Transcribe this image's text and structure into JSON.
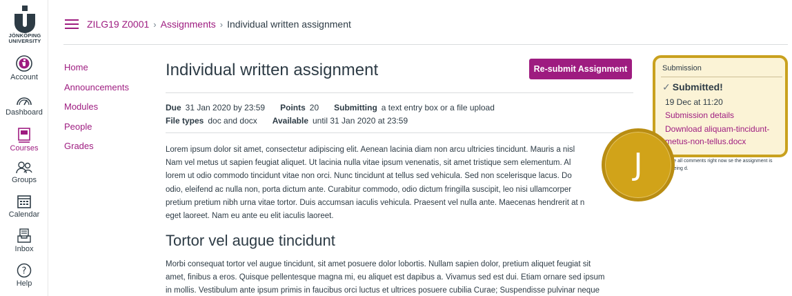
{
  "logo": {
    "line1": "JÖNKÖPING",
    "line2": "UNIVERSITY"
  },
  "global_nav": [
    {
      "label": "Account",
      "icon": "account-icon"
    },
    {
      "label": "Dashboard",
      "icon": "dashboard-icon"
    },
    {
      "label": "Courses",
      "icon": "courses-icon",
      "active": true
    },
    {
      "label": "Groups",
      "icon": "groups-icon"
    },
    {
      "label": "Calendar",
      "icon": "calendar-icon"
    },
    {
      "label": "Inbox",
      "icon": "inbox-icon"
    },
    {
      "label": "Help",
      "icon": "help-icon"
    }
  ],
  "breadcrumb": {
    "course": "ZILG19 Z0001",
    "section": "Assignments",
    "current": "Individual written assignment"
  },
  "course_nav": [
    "Home",
    "Announcements",
    "Modules",
    "People",
    "Grades"
  ],
  "assignment": {
    "title": "Individual written assignment",
    "resubmit_label": "Re-submit Assignment",
    "due_label": "Due",
    "due_value": "31 Jan 2020 by 23:59",
    "points_label": "Points",
    "points_value": "20",
    "submitting_label": "Submitting",
    "submitting_value": "a text entry box or a file upload",
    "filetypes_label": "File types",
    "filetypes_value": "doc and docx",
    "available_label": "Available",
    "available_value": "until 31 Jan 2020 at 23:59",
    "para1": [
      "Lorem ipsum dolor sit amet, consectetur adipiscing elit. Aenean lacinia diam non arcu ultricies tincidunt. Mauris a nisl",
      "Nam vel metus ut sapien feugiat aliquet. Ut lacinia nulla vitae ipsum venenatis, sit amet tristique sem elementum. Al",
      "lorem ut odio commodo tincidunt vitae non orci. Nunc tincidunt at tellus sed vehicula. Sed non scelerisque lacus. Do",
      "odio, eleifend ac nulla non, porta dictum ante. Curabitur commodo, odio dictum fringilla suscipit, leo nisi ullamcorper",
      "pretium pretium nibh urna vitae tortor. Duis accumsan iaculis vehicula. Praesent vel nulla ante. Maecenas hendrerit at n",
      "eget laoreet. Nam eu ante eu elit iaculis laoreet."
    ],
    "heading2": "Tortor vel augue tincidunt",
    "para2": [
      "Morbi consequat tortor vel augue tincidunt, sit amet posuere dolor lobortis. Nullam sapien dolor, pretium aliquet feugiat sit",
      "amet, finibus a eros. Quisque pellentesque magna mi, eu aliquet est dapibus a. Vivamus sed est dui. Etiam ornare sed ipsum",
      "in mollis. Vestibulum ante ipsum primis in faucibus orci luctus et ultrices posuere cubilia Curae; Suspendisse pulvinar neque"
    ]
  },
  "submission": {
    "heading": "Submission",
    "status": "Submitted!",
    "date": "19 Dec at 11:20",
    "details_link": "Submission details",
    "download_link": "Download aliquam-tincidunt-metus-non-tellus.docx",
    "note": "ight not see all comments right now se the assignment is currently being d."
  },
  "avatar": {
    "initial": "J"
  },
  "colors": {
    "accent": "#9e1c80",
    "highlight": "#c9a11e",
    "avatar": "#d1a319"
  }
}
